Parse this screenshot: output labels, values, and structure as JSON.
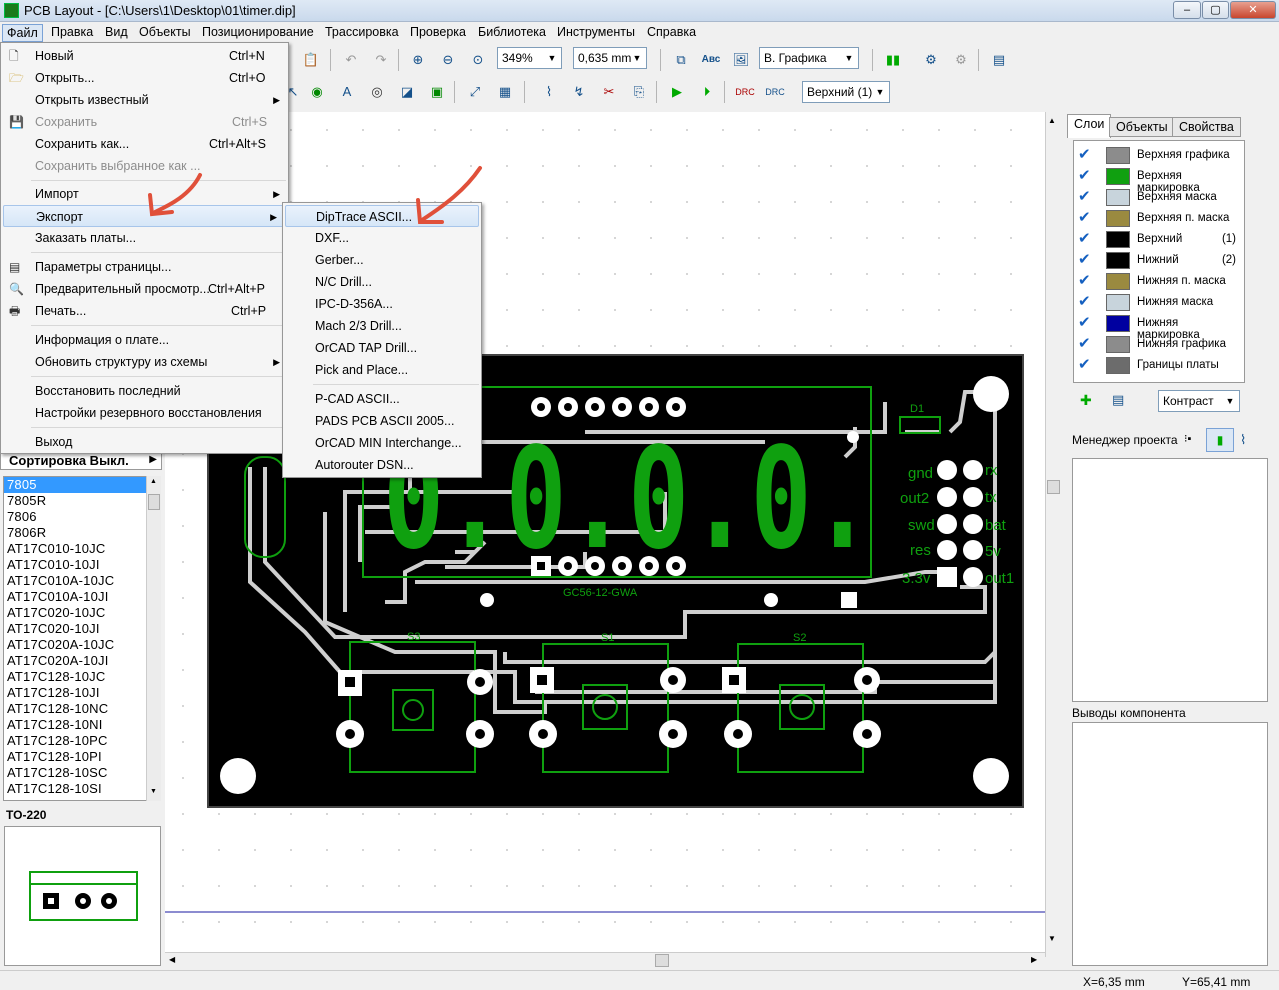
{
  "window": {
    "title": "PCB Layout - [C:\\Users\\1\\Desktop\\01\\timer.dip]",
    "min": "–",
    "max": "▢",
    "close": "✕"
  },
  "menubar": [
    "Файл",
    "Правка",
    "Вид",
    "Объекты",
    "Позиционирование",
    "Трассировка",
    "Проверка",
    "Библиотека",
    "Инструменты",
    "Справка"
  ],
  "toolbar": {
    "zoom": "349%",
    "grid": "0,635 mm",
    "layer_mode": "В. Графика",
    "layer": "Верхний (1)",
    "abc_label": "Авс"
  },
  "file_menu": {
    "items": [
      {
        "label": "Новый",
        "shortcut": "Ctrl+N",
        "icon": "new-file-icon",
        "enabled": true
      },
      {
        "label": "Открыть...",
        "shortcut": "Ctrl+O",
        "icon": "open-folder-icon",
        "enabled": true
      },
      {
        "label": "Открыть известный",
        "shortcut": "",
        "submenu": true,
        "enabled": true
      },
      {
        "label": "Сохранить",
        "shortcut": "Ctrl+S",
        "icon": "save-icon",
        "enabled": false
      },
      {
        "label": "Сохранить как...",
        "shortcut": "Ctrl+Alt+S",
        "enabled": true
      },
      {
        "label": "Сохранить выбранное как ...",
        "shortcut": "",
        "enabled": false
      },
      {
        "label": "Импорт",
        "shortcut": "",
        "submenu": true,
        "enabled": true
      },
      {
        "label": "Экспорт",
        "shortcut": "",
        "submenu": true,
        "enabled": true,
        "highlighted": true
      },
      {
        "label": "Заказать платы...",
        "shortcut": "",
        "enabled": true
      },
      {
        "label": "Параметры страницы...",
        "shortcut": "",
        "icon": "page-setup-icon",
        "enabled": true
      },
      {
        "label": "Предварительный просмотр...",
        "shortcut": "Ctrl+Alt+P",
        "icon": "print-preview-icon",
        "enabled": true
      },
      {
        "label": "Печать...",
        "shortcut": "Ctrl+P",
        "icon": "printer-icon",
        "enabled": true
      },
      {
        "label": "Информация о плате...",
        "shortcut": "",
        "enabled": true
      },
      {
        "label": "Обновить структуру из схемы",
        "shortcut": "",
        "submenu": true,
        "enabled": true
      },
      {
        "label": "Восстановить последний",
        "shortcut": "",
        "enabled": true
      },
      {
        "label": "Настройки резервного восстановления",
        "shortcut": "",
        "enabled": true
      },
      {
        "label": "Выход",
        "shortcut": "",
        "enabled": true
      }
    ]
  },
  "export_submenu": [
    "DipTrace ASCII...",
    "DXF...",
    "Gerber...",
    "N/C Drill...",
    "IPC-D-356A...",
    "Mach 2/3 Drill...",
    "OrCAD TAP Drill...",
    "Pick and Place...",
    "P-CAD ASCII...",
    "PADS PCB ASCII 2005...",
    "OrCAD MIN Interchange...",
    "Autorouter DSN..."
  ],
  "left_panel": {
    "sort_label": "Сортировка Выкл.",
    "components": [
      "7805",
      "7805R",
      "7806",
      "7806R",
      "AT17C010-10JC",
      "AT17C010-10JI",
      "AT17C010A-10JC",
      "AT17C010A-10JI",
      "AT17C020-10JC",
      "AT17C020-10JI",
      "AT17C020A-10JC",
      "AT17C020A-10JI",
      "AT17C128-10JC",
      "AT17C128-10JI",
      "AT17C128-10NC",
      "AT17C128-10NI",
      "AT17C128-10PC",
      "AT17C128-10PI",
      "AT17C128-10SC",
      "AT17C128-10SI"
    ],
    "selected": "7805",
    "package": "TO-220"
  },
  "right_panel": {
    "tabs": [
      "Слои",
      "Объекты",
      "Свойства"
    ],
    "layers": [
      {
        "name": "Верхняя графика",
        "color": "#8c8c8c",
        "num": ""
      },
      {
        "name": "Верхняя маркировка",
        "color": "#10a010",
        "num": ""
      },
      {
        "name": "Верхняя маска",
        "color": "#c8d4dc",
        "num": ""
      },
      {
        "name": "Верхняя п. маска",
        "color": "#9a8a40",
        "num": ""
      },
      {
        "name": "Верхний",
        "color": "#000000",
        "num": "(1)"
      },
      {
        "name": "Нижний",
        "color": "#000000",
        "num": "(2)"
      },
      {
        "name": "Нижняя п. маска",
        "color": "#9a8a40",
        "num": ""
      },
      {
        "name": "Нижняя маска",
        "color": "#c8d4dc",
        "num": ""
      },
      {
        "name": "Нижняя маркировка",
        "color": "#0000a0",
        "num": ""
      },
      {
        "name": "Нижняя графика",
        "color": "#8c8c8c",
        "num": ""
      },
      {
        "name": "Границы платы",
        "color": "#6c6c6c",
        "num": ""
      }
    ],
    "contrast": "Контраст",
    "project_manager": "Менеджер проекта",
    "component_pins": "Выводы компонента"
  },
  "pcb": {
    "silk_labels": [
      "D1",
      "gnd",
      "rx",
      "out2",
      "tx",
      "swd",
      "bat",
      "res",
      "5v",
      "3.3v",
      "out1",
      "S3",
      "S1",
      "S2",
      "GC56-12-GWA"
    ],
    "display_digits": "0.0.0.0."
  },
  "status": {
    "x": "X=6,35 mm",
    "y": "Y=65,41 mm"
  },
  "colors": {
    "silk": "#0fa00f",
    "board": "#000000",
    "trace": "#cfcfcf",
    "accent": "#3399ff",
    "arrow": "#e0503a"
  }
}
